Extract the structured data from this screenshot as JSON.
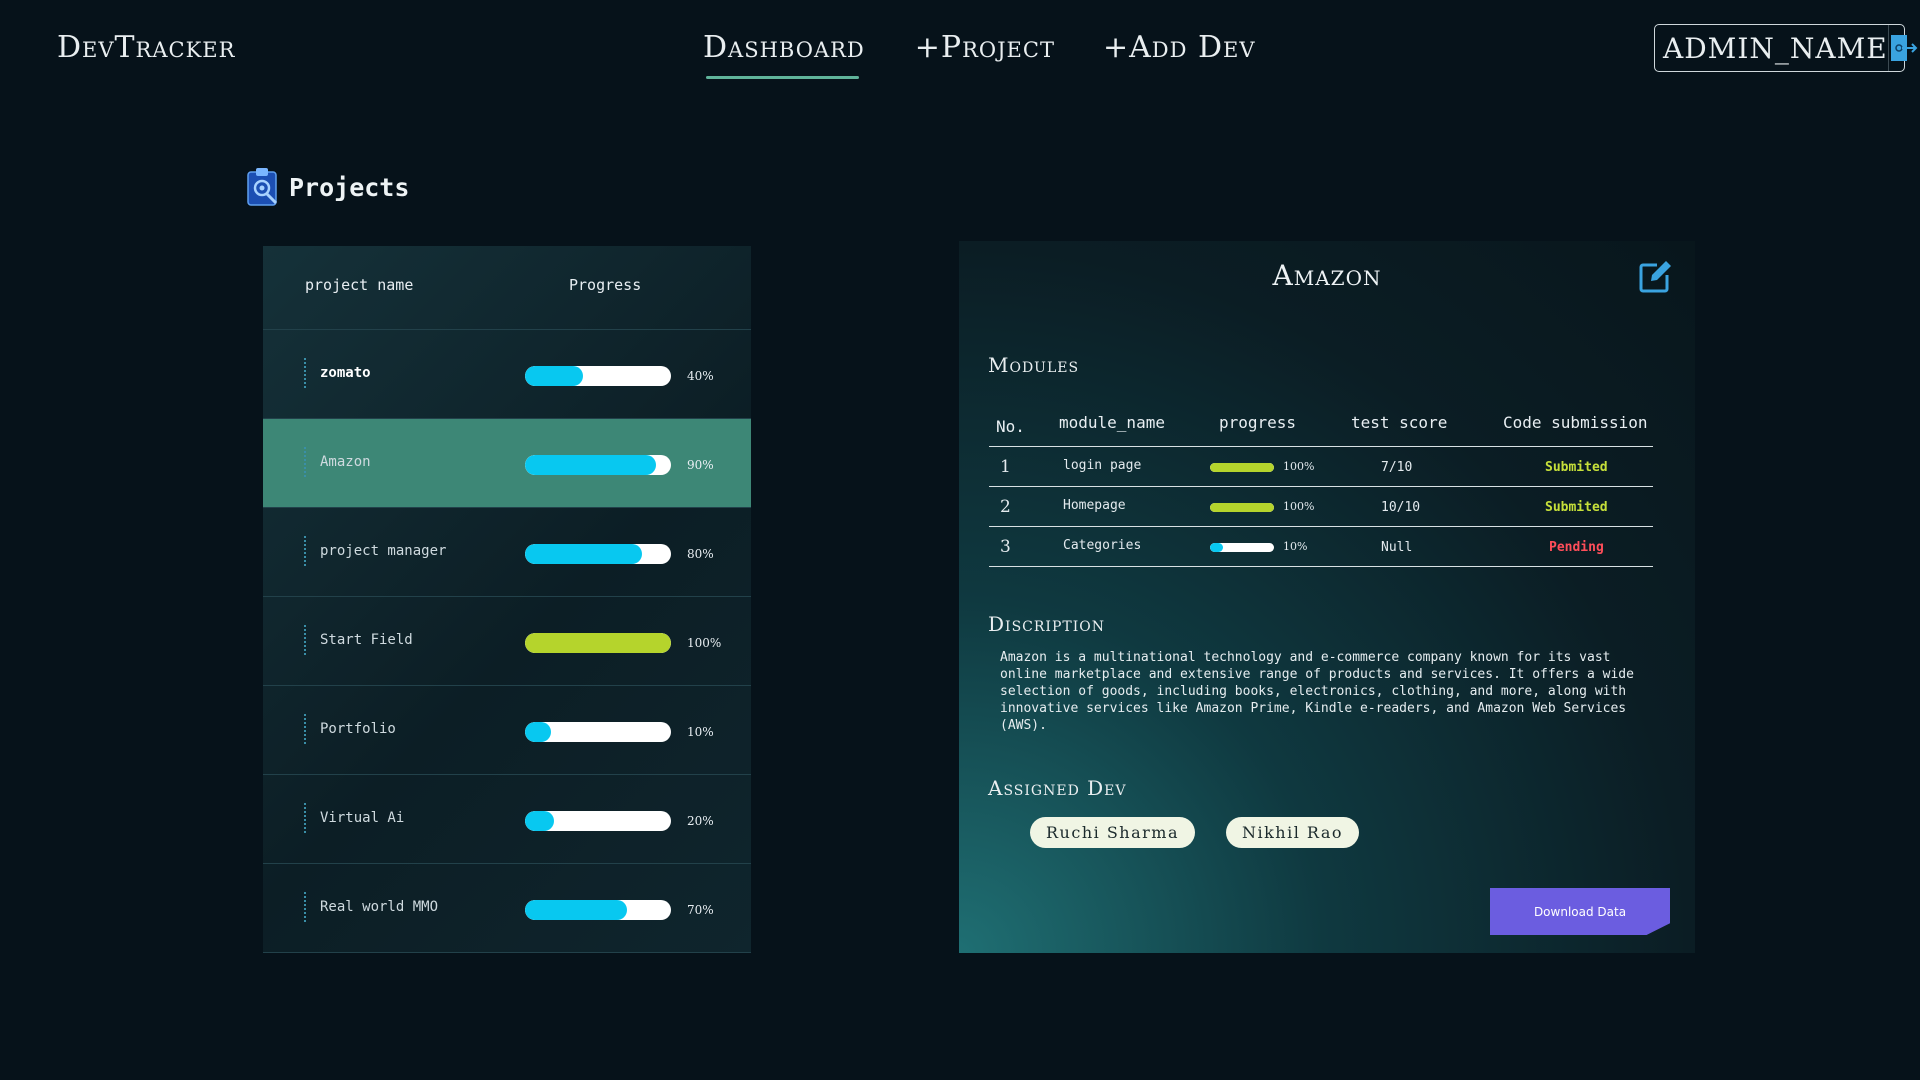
{
  "header": {
    "brand": "DevTracker",
    "nav": [
      {
        "label": "Dashboard",
        "active": true
      },
      {
        "label": "+Project",
        "active": false
      },
      {
        "label": "+Add Dev",
        "active": false
      }
    ],
    "admin_name": "ADMIN_NAME",
    "logout_icon": "logout-icon"
  },
  "projects": {
    "title": "Projects",
    "icon": "clipboard-gear-icon",
    "columns": [
      "project name",
      "Progress"
    ],
    "rows": [
      {
        "name": "zomato",
        "progress": 40,
        "label": "40%",
        "selected": false
      },
      {
        "name": "Amazon",
        "progress": 90,
        "label": "90%",
        "selected": true
      },
      {
        "name": "project manager",
        "progress": 80,
        "label": "80%",
        "selected": false
      },
      {
        "name": "Start Field",
        "progress": 100,
        "label": "100%",
        "selected": false
      },
      {
        "name": "Portfolio",
        "progress": 10,
        "label": "10%",
        "selected": false
      },
      {
        "name": "Virtual Ai",
        "progress": 20,
        "label": "20%",
        "selected": false
      },
      {
        "name": "Real world MMO",
        "progress": 70,
        "label": "70%",
        "selected": false
      }
    ]
  },
  "detail": {
    "title": "Amazon",
    "edit_icon": "edit-icon",
    "modules_title": "Modules",
    "module_columns": [
      "No.",
      "module_name",
      "progress",
      "test score",
      "Code submission"
    ],
    "modules": [
      {
        "no": "1",
        "name": "login page",
        "progress": 100,
        "label": "100%",
        "score": "7/10",
        "status": "Submited"
      },
      {
        "no": "2",
        "name": "Homepage",
        "progress": 100,
        "label": "100%",
        "score": "10/10",
        "status": "Submited"
      },
      {
        "no": "3",
        "name": "Categories",
        "progress": 10,
        "label": "10%",
        "score": "Null",
        "status": "Pending"
      }
    ],
    "description_title": "Discription",
    "description": "Amazon is a multinational technology and e-commerce company known for its vast online marketplace and extensive range of products and services. It offers a wide selection of goods, including books, electronics, clothing, and more, along with innovative services like Amazon Prime, Kindle e-readers, and Amazon Web Services (AWS).",
    "assigned_title": "Assigned Dev",
    "devs": [
      "Ruchi Sharma",
      "Nikhil Rao"
    ],
    "download_label": "Download Data"
  },
  "colors": {
    "background": "#06121a",
    "progress_fill": "#08c8f0",
    "progress_complete": "#b5d42c",
    "selected_row": "#3d8776",
    "submitted": "#c6e03a",
    "pending": "#ff4e5a",
    "download_button": "#6b5de0"
  }
}
